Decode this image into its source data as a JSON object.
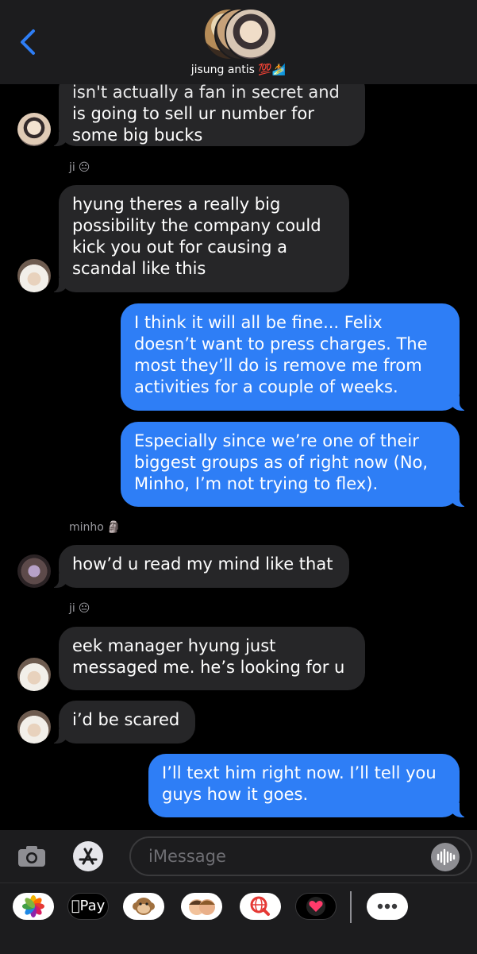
{
  "header": {
    "chat_name": "jisung antis 💯🏄"
  },
  "messages": [
    {
      "partial_text": "isn't actually a fan in secret and",
      "text": "is going to sell ur number for some big bucks"
    },
    {
      "sender": "ji",
      "sender_emoji": "😐",
      "text": "hyung theres a really big possibility the company could kick you out for causing a scandal like this"
    },
    {
      "text": "I think it will all be fine... Felix doesn’t want to press charges. The most they’ll do is remove me from activities for a couple of weeks."
    },
    {
      "text": "Especially since we’re one of their biggest groups as of right now (No, Minho, I’m not trying to flex)."
    },
    {
      "sender": "minho",
      "sender_emoji": "🗿",
      "text": "how’d u read my mind like that"
    },
    {
      "sender": "ji",
      "sender_emoji": "😐",
      "text": "eek manager hyung just messaged me. he’s looking for u"
    },
    {
      "text": "i’d be scared"
    },
    {
      "text": "I’ll text him right now. I’ll tell you guys how it goes."
    }
  ],
  "composer": {
    "placeholder": "iMessage"
  },
  "tray": {
    "apple_pay_label": "Pay"
  }
}
